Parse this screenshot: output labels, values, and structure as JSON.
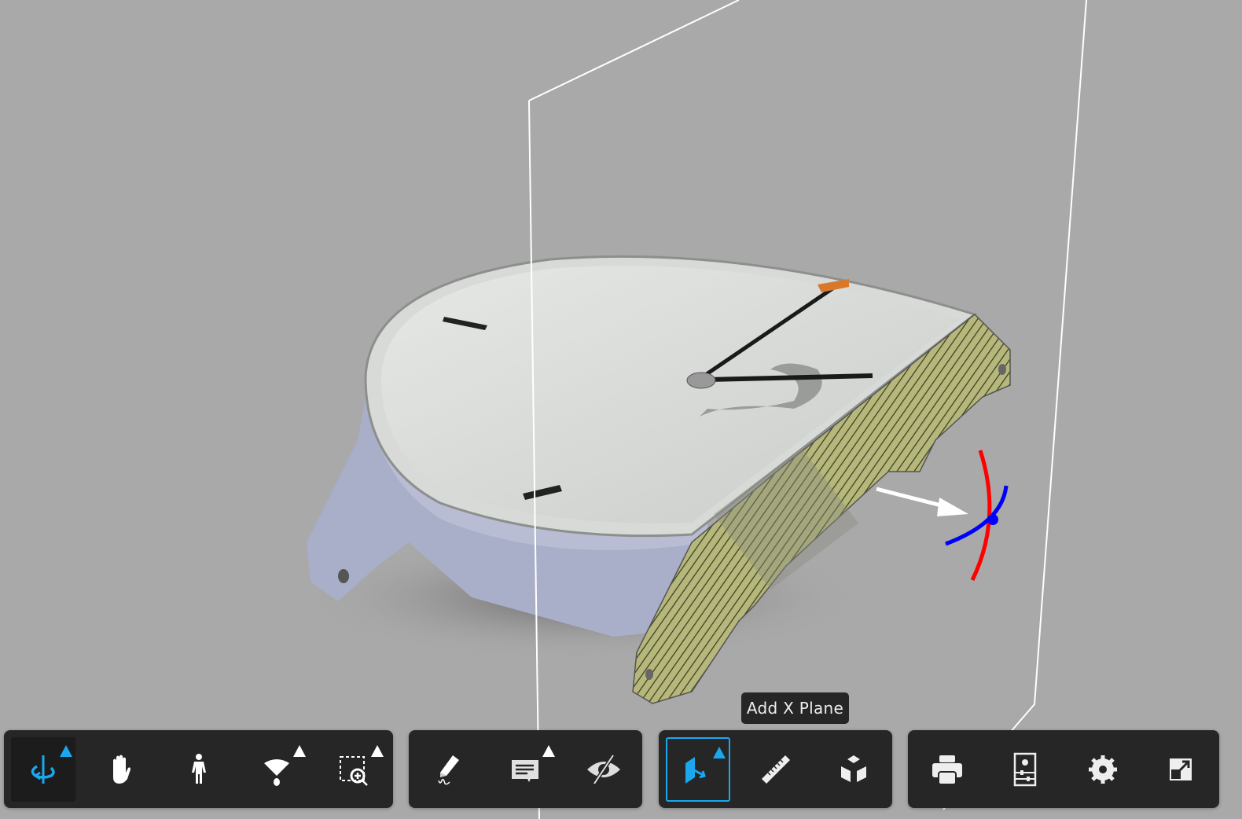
{
  "viewer": {
    "accent_color": "#1aa7ee",
    "background_color": "#a9a9a9"
  },
  "tooltip": {
    "text": "Add X Plane"
  },
  "toolbar": {
    "navigation": [
      {
        "name": "orbit",
        "icon": "orbit-icon",
        "has_flyout": true,
        "active": true
      },
      {
        "name": "pan",
        "icon": "hand-icon",
        "has_flyout": false
      },
      {
        "name": "first-person",
        "icon": "person-icon",
        "has_flyout": false
      },
      {
        "name": "camera",
        "icon": "camera-view-icon",
        "has_flyout": true
      },
      {
        "name": "zoom-window",
        "icon": "zoom-window-icon",
        "has_flyout": true
      }
    ],
    "review": [
      {
        "name": "markup",
        "icon": "pencil-icon",
        "has_flyout": false
      },
      {
        "name": "comments",
        "icon": "comment-icon",
        "has_flyout": true
      },
      {
        "name": "hide",
        "icon": "eye-off-icon",
        "has_flyout": false
      }
    ],
    "analysis": [
      {
        "name": "section",
        "icon": "section-plane-icon",
        "has_flyout": true,
        "selected": true
      },
      {
        "name": "measure",
        "icon": "ruler-icon",
        "has_flyout": false
      },
      {
        "name": "explode",
        "icon": "explode-cube-icon",
        "has_flyout": false
      }
    ],
    "settings": [
      {
        "name": "print",
        "icon": "printer-icon"
      },
      {
        "name": "properties",
        "icon": "properties-icon"
      },
      {
        "name": "settings",
        "icon": "gear-icon"
      },
      {
        "name": "fullscreen",
        "icon": "fullscreen-icon"
      }
    ]
  }
}
